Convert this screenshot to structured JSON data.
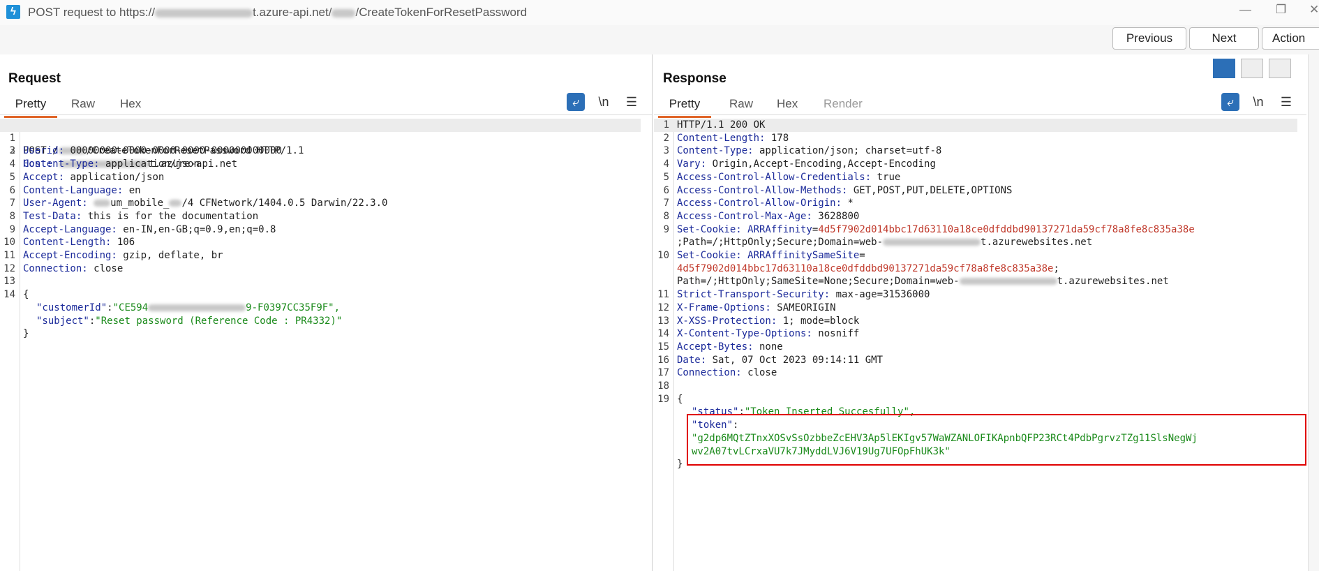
{
  "window": {
    "title_prefix": "POST request to https://",
    "title_domain": "t.azure-api.net/",
    "title_path": "/CreateTokenForResetPassword",
    "minimize": "—",
    "restore": "❐",
    "close": "✕"
  },
  "toolbar": {
    "previous": "Previous",
    "next": "Next",
    "action": "Action"
  },
  "request": {
    "title": "Request",
    "tabs": [
      "Pretty",
      "Raw",
      "Hex"
    ],
    "newline_label": "\\n",
    "lines": [
      {
        "n": "1",
        "text": "POST /",
        "rest": "/CreateTokenForResetPassword HTTP/1.1"
      },
      {
        "n": "2",
        "name": "Host:",
        "value": "t.azure-api.net"
      },
      {
        "n": "3",
        "name": "Userid:",
        "value": " 00000000-0000-0000-0000-000000000000"
      },
      {
        "n": "4",
        "name": "Content-Type:",
        "value": " application/json"
      },
      {
        "n": "5",
        "name": "Accept:",
        "value": " application/json"
      },
      {
        "n": "6",
        "name": "Content-Language:",
        "value": " en"
      },
      {
        "n": "7",
        "name": "User-Agent:",
        "value": "um_mobile_",
        "value2": "/4 CFNetwork/1404.0.5 Darwin/22.3.0"
      },
      {
        "n": "8",
        "name": "Test-Data:",
        "value": " this is for the documentation"
      },
      {
        "n": "9",
        "name": "Accept-Language:",
        "value": " en-IN,en-GB;q=0.9,en;q=0.8"
      },
      {
        "n": "10",
        "name": "Content-Length:",
        "value": " 106"
      },
      {
        "n": "11",
        "name": "Accept-Encoding:",
        "value": " gzip, deflate, br"
      },
      {
        "n": "12",
        "name": "Connection:",
        "value": " close"
      },
      {
        "n": "13"
      },
      {
        "n": "14",
        "text": "{"
      }
    ],
    "body": {
      "customer_key": "\"customerId\"",
      "customer_val_start": "\"CE594",
      "customer_val_end": "9-F0397CC35F9F\",",
      "subject_key": "\"subject\"",
      "subject_val": "\"Reset password (Reference Code : PR4332)\"",
      "close": "}"
    }
  },
  "response": {
    "title": "Response",
    "tabs": [
      "Pretty",
      "Raw",
      "Hex",
      "Render"
    ],
    "newline_label": "\\n",
    "lines": [
      {
        "n": "1",
        "text": "HTTP/1.1 200 OK"
      },
      {
        "n": "2",
        "name": "Content-Length:",
        "value": " 178"
      },
      {
        "n": "3",
        "name": "Content-Type:",
        "value": " application/json; charset=utf-8"
      },
      {
        "n": "4",
        "name": "Vary:",
        "value": " Origin,Accept-Encoding,Accept-Encoding"
      },
      {
        "n": "5",
        "name": "Access-Control-Allow-Credentials:",
        "value": " true"
      },
      {
        "n": "6",
        "name": "Access-Control-Allow-Methods:",
        "value": " GET,POST,PUT,DELETE,OPTIONS"
      },
      {
        "n": "7",
        "name": "Access-Control-Allow-Origin:",
        "value": " *"
      },
      {
        "n": "8",
        "name": "Access-Control-Max-Age:",
        "value": " 3628800"
      }
    ],
    "cookie1": {
      "n": "9",
      "name": "Set-Cookie:",
      "cname": " ARRAffinity",
      "cval": "4d5f7902d014bbc17d63110a18ce0dfddbd90137271da59cf78a8fe8c835a38e",
      "cont": ";Path=/;HttpOnly;Secure;Domain=web-",
      "cont_end": "t.azurewebsites.net"
    },
    "cookie2": {
      "n": "10",
      "name": "Set-Cookie:",
      "cname": " ARRAffinitySameSite",
      "cval": "4d5f7902d014bbc17d63110a18ce0dfddbd90137271da59cf78a8fe8c835a38e",
      "cont": "Path=/;HttpOnly;SameSite=None;Secure;Domain=web-",
      "cont_end": "t.azurewebsites.net"
    },
    "lines2": [
      {
        "n": "11",
        "name": "Strict-Transport-Security:",
        "value": " max-age=31536000"
      },
      {
        "n": "12",
        "name": "X-Frame-Options:",
        "value": " SAMEORIGIN"
      },
      {
        "n": "13",
        "name": "X-XSS-Protection:",
        "value": " 1; mode=block"
      },
      {
        "n": "14",
        "name": "X-Content-Type-Options:",
        "value": " nosniff"
      },
      {
        "n": "15",
        "name": "Accept-Bytes:",
        "value": " none"
      },
      {
        "n": "16",
        "name": "Date:",
        "value": " Sat, 07 Oct 2023 09:14:11 GMT"
      },
      {
        "n": "17",
        "name": "Connection:",
        "value": " close"
      },
      {
        "n": "18"
      },
      {
        "n": "19",
        "text": "{"
      }
    ],
    "body": {
      "status_key": "\"status\"",
      "status_val": "\"Token Inserted Succesfully\",",
      "token_key": "\"token\"",
      "token_line1": "\"g2dp6MQtZTnxXOSvSsOzbbeZcEHV3Ap5lEKIgv57WaWZANLOFIKApnbQFP23RCt4PdbPgrvzTZg11SlsNegWj",
      "token_line2": "wv2A07tvLCrxaVU7k7JMyddLVJ6V19Ug7UFOpFhUK3k\"",
      "close": "}"
    }
  },
  "colors": {
    "accent": "#e0662a",
    "blue": "#2c6fb7",
    "highlight": "#e00000"
  }
}
